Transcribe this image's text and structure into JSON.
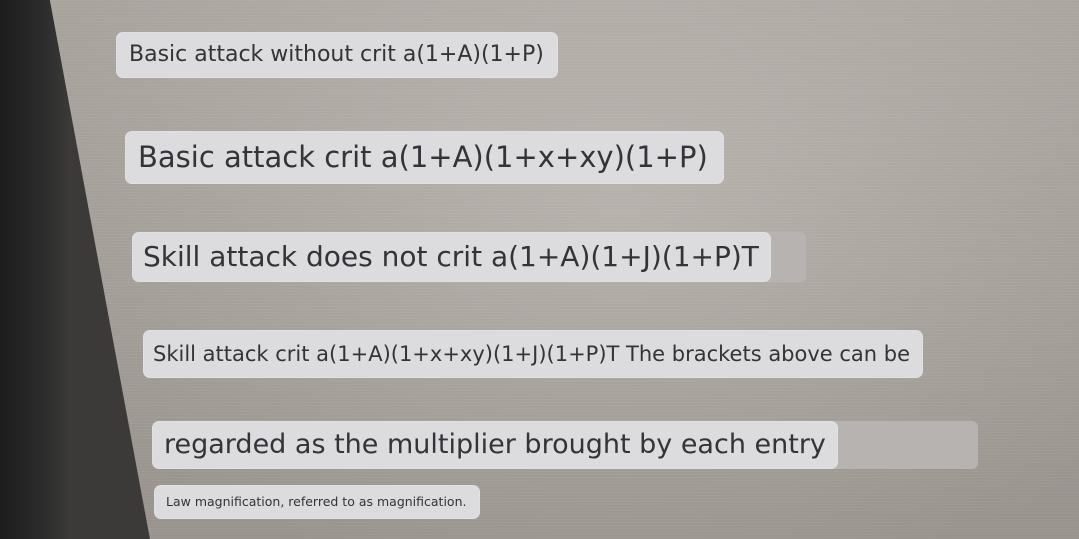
{
  "lines": [
    {
      "text": "Basic attack without crit a(1+A)(1+P)"
    },
    {
      "text": "Basic attack crit a(1+A)(1+x+xy)(1+P)"
    },
    {
      "text": "Skill attack does not crit a(1+A)(1+J)(1+P)T"
    },
    {
      "text": "Skill attack crit a(1+A)(1+x+xy)(1+J)(1+P)T The brackets above can be"
    },
    {
      "text": "regarded as the multiplier brought by each entry"
    },
    {
      "text": "Law magnification, referred to as magnification."
    }
  ],
  "colors": {
    "bubble_background": "#dcdcdf",
    "bubble_text": "#333338",
    "screen_background": "#b0aaa4",
    "bezel": "#2a2a2a"
  }
}
